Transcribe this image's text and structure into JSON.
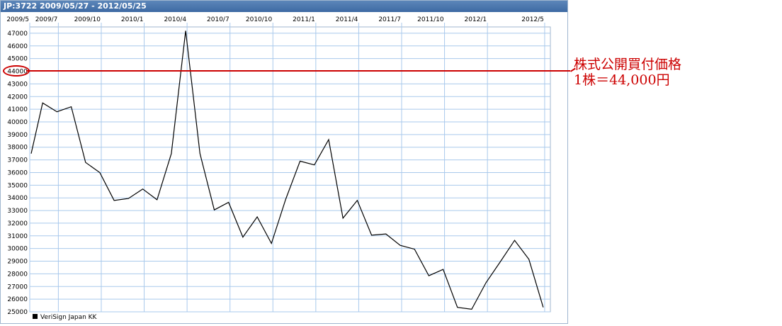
{
  "header": {
    "title": "JP:3722 2009/05/27 - 2012/05/25"
  },
  "annotation": {
    "line1": "株式公開買付価格",
    "line2": "1株＝44,000円",
    "color": "#cc0000"
  },
  "chart_data": {
    "type": "line",
    "title": "JP:3722 2009/05/27 - 2012/05/25",
    "x_ticks": [
      {
        "label": "2009/5",
        "t": 0
      },
      {
        "label": "2009/7",
        "t": 2
      },
      {
        "label": "2009/10",
        "t": 5
      },
      {
        "label": "2010/1",
        "t": 8
      },
      {
        "label": "2010/4",
        "t": 11
      },
      {
        "label": "2010/7",
        "t": 14
      },
      {
        "label": "2010/10",
        "t": 17
      },
      {
        "label": "2011/1",
        "t": 20
      },
      {
        "label": "2011/4",
        "t": 23
      },
      {
        "label": "2011/7",
        "t": 26
      },
      {
        "label": "2011/10",
        "t": 29
      },
      {
        "label": "2012/1",
        "t": 32
      },
      {
        "label": "2012/5",
        "t": 36
      }
    ],
    "ylim": [
      25000,
      47500
    ],
    "y_ticks": [
      25000,
      26000,
      27000,
      28000,
      29000,
      30000,
      31000,
      32000,
      33000,
      34000,
      35000,
      36000,
      37000,
      38000,
      39000,
      40000,
      41000,
      42000,
      43000,
      44000,
      45000,
      46000,
      47000
    ],
    "grid": true,
    "legend_position": "bottom-left",
    "reference_line": {
      "y": 44000,
      "label_tick": "44000",
      "color": "#cc0000"
    },
    "series": [
      {
        "name": "VeriSign Japan KK",
        "color": "#000000",
        "points": [
          [
            0.1,
            37500
          ],
          [
            0.9,
            41500
          ],
          [
            1.9,
            40800
          ],
          [
            2.9,
            41200
          ],
          [
            3.9,
            36800
          ],
          [
            4.9,
            36000
          ],
          [
            5.9,
            33800
          ],
          [
            6.9,
            33950
          ],
          [
            7.9,
            34700
          ],
          [
            8.9,
            33850
          ],
          [
            9.9,
            37500
          ],
          [
            10.9,
            47200
          ],
          [
            11.9,
            37500
          ],
          [
            12.9,
            33050
          ],
          [
            13.9,
            33650
          ],
          [
            14.9,
            30900
          ],
          [
            15.9,
            32500
          ],
          [
            16.9,
            30400
          ],
          [
            17.9,
            33900
          ],
          [
            18.9,
            36900
          ],
          [
            19.9,
            36600
          ],
          [
            20.9,
            38600
          ],
          [
            21.9,
            32400
          ],
          [
            22.9,
            33800
          ],
          [
            23.9,
            31050
          ],
          [
            24.9,
            31150
          ],
          [
            25.9,
            30250
          ],
          [
            26.9,
            29950
          ],
          [
            27.9,
            27850
          ],
          [
            28.9,
            28350
          ],
          [
            29.9,
            25350
          ],
          [
            30.9,
            25200
          ],
          [
            31.9,
            27300
          ],
          [
            32.9,
            28950
          ],
          [
            33.9,
            30650
          ],
          [
            34.9,
            29150
          ],
          [
            35.9,
            25350
          ]
        ]
      }
    ]
  }
}
